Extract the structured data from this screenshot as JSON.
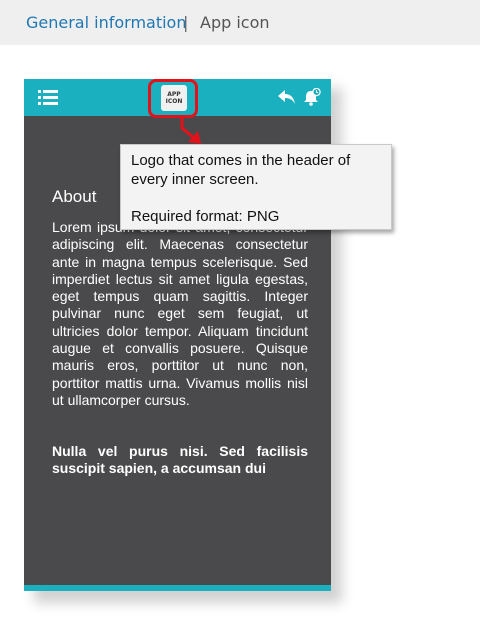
{
  "breadcrumb": {
    "link_label": "General information",
    "separator": "|",
    "current": "App icon"
  },
  "phone": {
    "header": {
      "app_icon_line1": "APP",
      "app_icon_line2": "ICON",
      "icons": [
        "menu-icon",
        "app-icon",
        "reply-icon",
        "notification-bell-icon"
      ],
      "color": "#1bb0bf"
    },
    "about_title": "About",
    "about_body": "Lorem ipsum dolor sit amet, consectetur adipiscing elit. Maecenas consectetur ante in magna tempus scelerisque. Sed imperdiet lectus sit amet ligula egestas, eget tempus quam sagittis. Integer pulvinar nunc eget sem feugiat, ut ultricies dolor tempor. Aliquam tincidunt augue et convallis posuere. Quisque mauris eros, porttitor ut nunc non, porttitor mattis urna. Vivamus mollis nisl ut ullamcorper cursus.",
    "about_bold": "Nulla vel purus nisi. Sed facilisis suscipit sapien, a accumsan dui",
    "background": "#4a4a4c"
  },
  "callout": {
    "line1": "Logo that comes in the header of every inner screen.",
    "line2": "Required format: PNG",
    "accent": "#e2121b"
  }
}
